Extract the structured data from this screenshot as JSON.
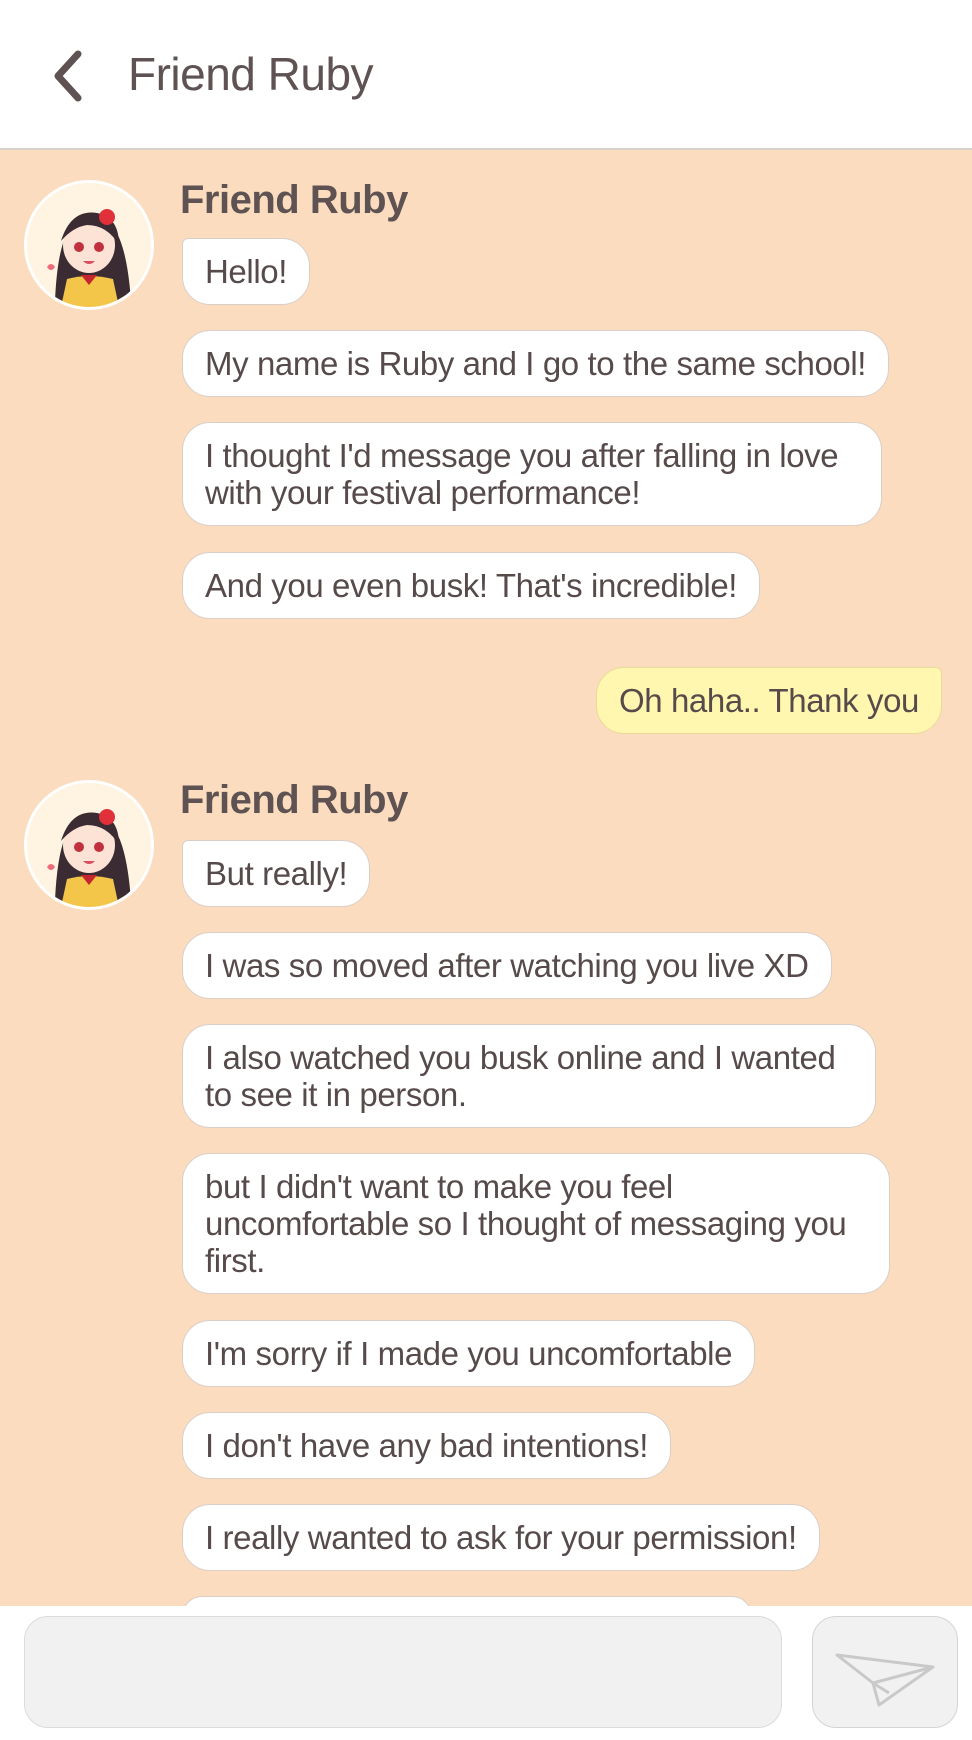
{
  "header": {
    "title": "Friend Ruby",
    "back_icon": "chevron-left-icon"
  },
  "messages": [
    {
      "sender": "Friend Ruby",
      "bubbles": [
        "Hello!",
        "My name is Ruby and I go to the same school!",
        "I thought I'd message you after falling in love with your festival performance!",
        "And you even busk! That's incredible!"
      ]
    },
    {
      "mine": "Oh haha.. Thank you"
    },
    {
      "sender": "Friend Ruby",
      "bubbles": [
        "But really!",
        "I was so moved after watching you live XD",
        "I also watched you busk online and I wanted to see it in person.",
        "but I didn't want to make you feel uncomfortable so I thought of messaging you first.",
        "I'm sorry if I made you uncomfortable",
        "I don't have any bad intentions!",
        "I really wanted to ask for your permission!"
      ]
    }
  ],
  "composer": {
    "placeholder": "",
    "send_icon": "paper-plane-icon"
  },
  "colors": {
    "chat_bg": "#fbdcbe",
    "my_bubble": "#fff6b0",
    "their_bubble": "#ffffff"
  }
}
